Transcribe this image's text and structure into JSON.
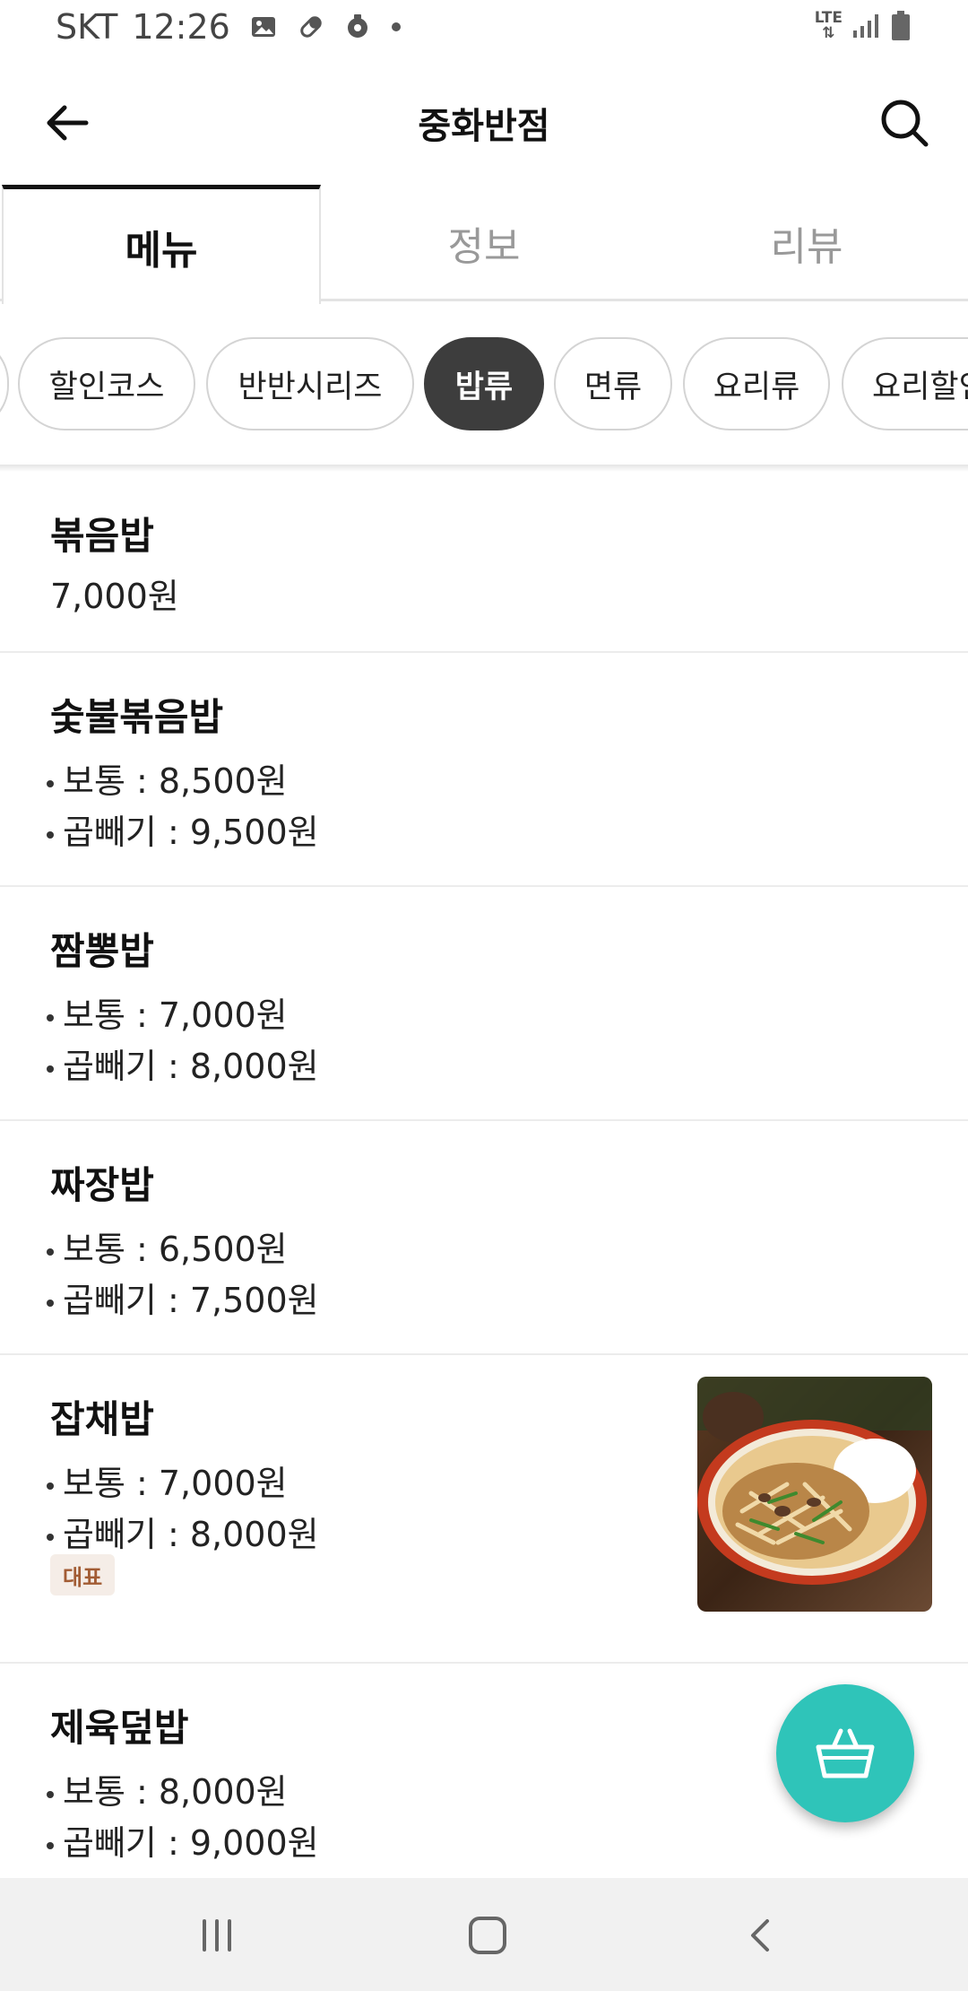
{
  "status_bar": {
    "carrier": "SKT",
    "time": "12:26",
    "network": "LTE",
    "icons": [
      "image-icon",
      "pill-icon",
      "location-icon",
      "dot-icon",
      "signal-icon",
      "battery-icon"
    ]
  },
  "header": {
    "title": "중화반점",
    "back_icon": "arrow-left-icon",
    "search_icon": "search-icon"
  },
  "tabs": [
    {
      "label": "메뉴",
      "active": true
    },
    {
      "label": "정보",
      "active": false
    },
    {
      "label": "리뷰",
      "active": false
    }
  ],
  "categories": [
    {
      "label": "할인코스",
      "active": false
    },
    {
      "label": "반반시리즈",
      "active": false
    },
    {
      "label": "밥류",
      "active": true
    },
    {
      "label": "면류",
      "active": false
    },
    {
      "label": "요리류",
      "active": false
    },
    {
      "label": "요리할인",
      "active": false
    }
  ],
  "menu": {
    "items": [
      {
        "name": "볶음밥",
        "price": "7,000원"
      },
      {
        "name": "숯불볶음밥",
        "options": [
          "보통 : 8,500원",
          "곱빼기 : 9,500원"
        ]
      },
      {
        "name": "짬뽕밥",
        "options": [
          "보통 : 7,000원",
          "곱빼기 : 8,000원"
        ]
      },
      {
        "name": "짜장밥",
        "options": [
          "보통 : 6,500원",
          "곱빼기 : 7,500원"
        ]
      },
      {
        "name": "잡채밥",
        "options": [
          "보통 : 7,000원",
          "곱빼기 : 8,000원"
        ],
        "badge": "대표",
        "has_image": true
      },
      {
        "name": "제육덮밥",
        "options": [
          "보통 : 8,000원",
          "곱빼기 : 9,000원"
        ]
      }
    ]
  },
  "cart_button": {
    "icon": "basket-icon",
    "color": "#2fc4b9"
  },
  "nav_bar": {
    "icons": [
      "recent-apps-icon",
      "home-icon",
      "back-icon"
    ]
  },
  "colors": {
    "accent": "#2fc4b9",
    "chip_active": "#3d3d3d",
    "badge_bg": "#f5ede7",
    "badge_text": "#a25c34"
  }
}
